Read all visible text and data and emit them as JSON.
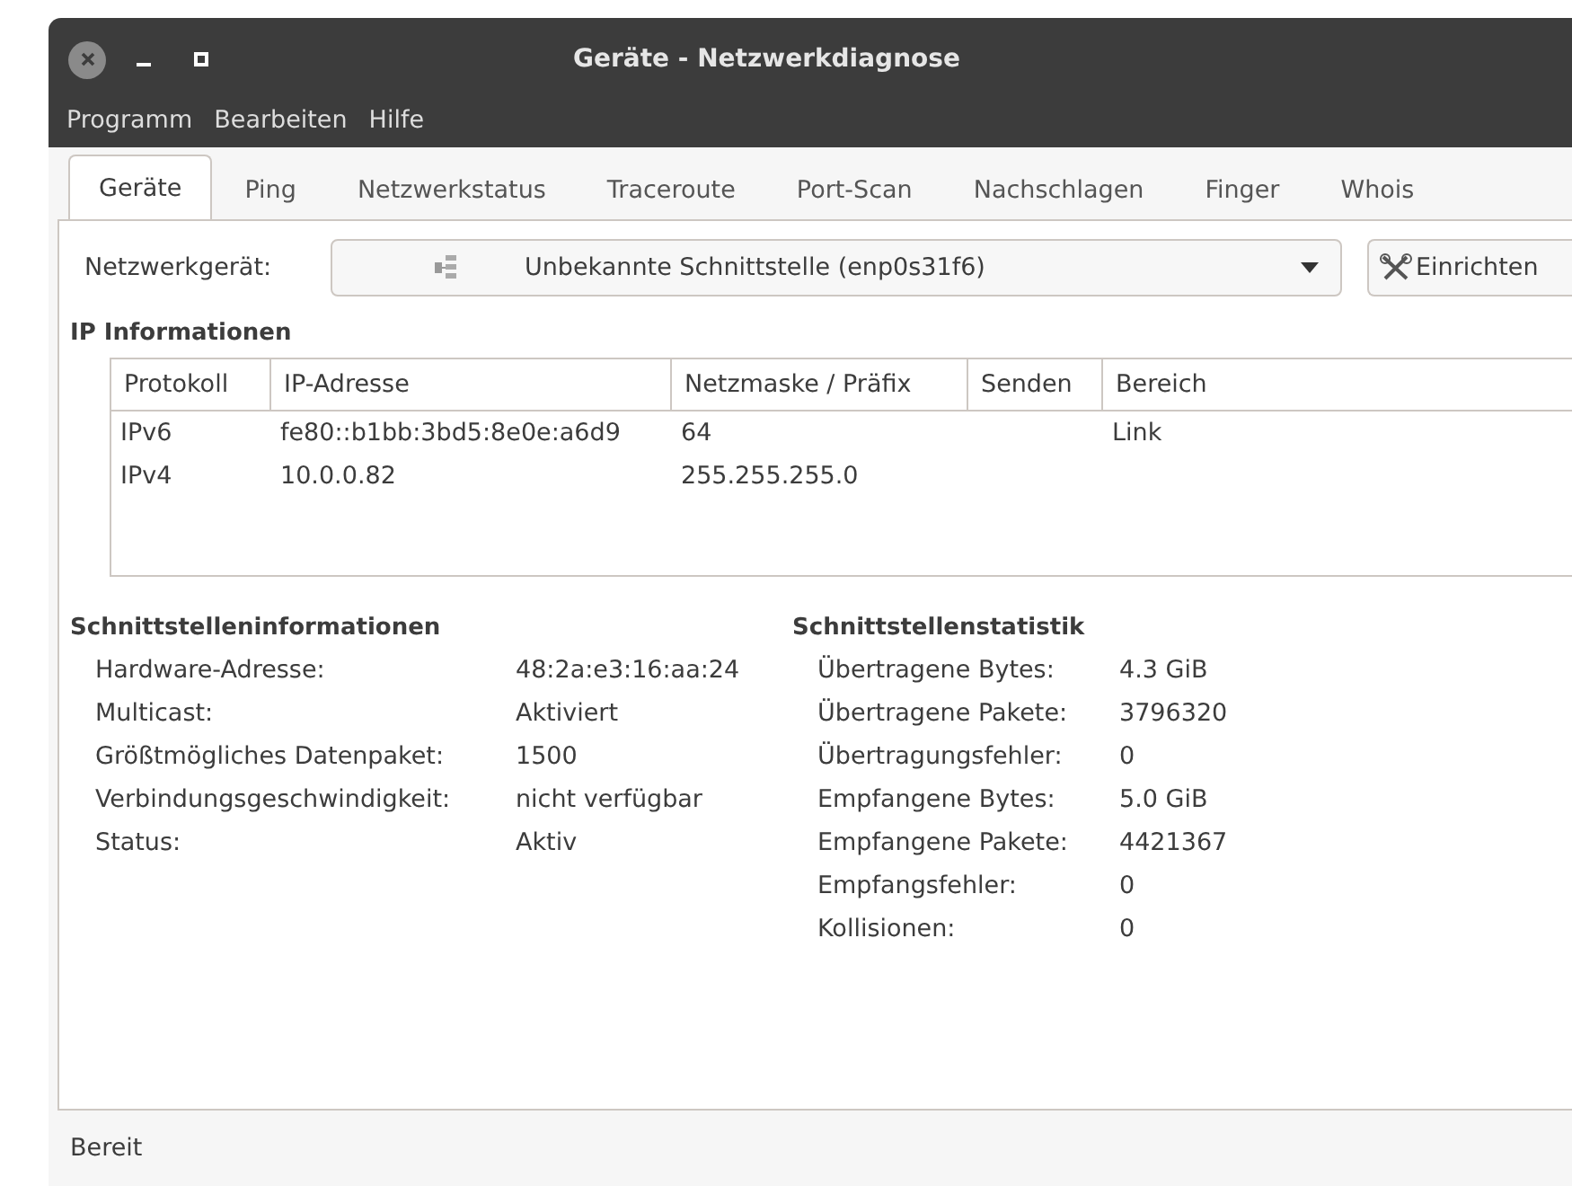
{
  "window": {
    "title": "Geräte - Netzwerkdiagnose"
  },
  "menu": [
    "Programm",
    "Bearbeiten",
    "Hilfe"
  ],
  "tabs": [
    {
      "label": "Geräte",
      "selected": true
    },
    {
      "label": "Ping",
      "selected": false
    },
    {
      "label": "Netzwerkstatus",
      "selected": false
    },
    {
      "label": "Traceroute",
      "selected": false
    },
    {
      "label": "Port-Scan",
      "selected": false
    },
    {
      "label": "Nachschlagen",
      "selected": false
    },
    {
      "label": "Finger",
      "selected": false
    },
    {
      "label": "Whois",
      "selected": false
    }
  ],
  "device": {
    "label": "Netzwerkgerät:",
    "value": "Unbekannte Schnittstelle (enp0s31f6)",
    "button": "Einrichten"
  },
  "ip_info": {
    "title": "IP Informationen",
    "columns": [
      "Protokoll",
      "IP-Adresse",
      "Netzmaske / Präfix",
      "Senden",
      "Bereich"
    ],
    "rows": [
      [
        "IPv6",
        "fe80::b1bb:3bd5:8e0e:a6d9",
        "64",
        "",
        "Link"
      ],
      [
        "IPv4",
        "10.0.0.82",
        "255.255.255.0",
        "",
        ""
      ]
    ]
  },
  "interface_info": {
    "title": "Schnittstelleninformationen",
    "rows": [
      {
        "label": "Hardware-Adresse:",
        "value": "48:2a:e3:16:aa:24"
      },
      {
        "label": "Multicast:",
        "value": "Aktiviert"
      },
      {
        "label": "Größtmögliches Datenpaket:",
        "value": "1500"
      },
      {
        "label": "Verbindungsgeschwindigkeit:",
        "value": "nicht verfügbar"
      },
      {
        "label": "Status:",
        "value": "Aktiv"
      }
    ]
  },
  "interface_stats": {
    "title": "Schnittstellenstatistik",
    "rows": [
      {
        "label": "Übertragene Bytes:",
        "value": "4.3 GiB"
      },
      {
        "label": "Übertragene Pakete:",
        "value": "3796320"
      },
      {
        "label": "Übertragungsfehler:",
        "value": "0"
      },
      {
        "label": "Empfangene Bytes:",
        "value": "5.0 GiB"
      },
      {
        "label": "Empfangene Pakete:",
        "value": "4421367"
      },
      {
        "label": "Empfangsfehler:",
        "value": "0"
      },
      {
        "label": "Kollisionen:",
        "value": "0"
      }
    ]
  },
  "status_bar": "Bereit"
}
